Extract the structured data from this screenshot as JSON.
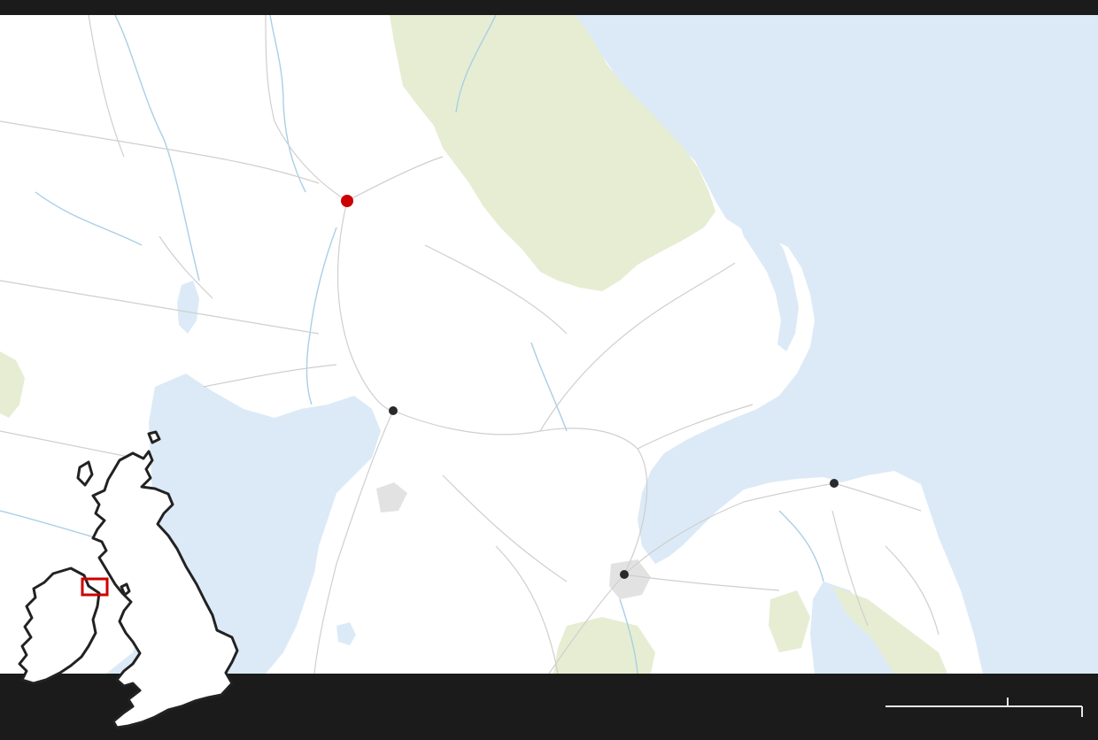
{
  "map": {
    "colors": {
      "land": "#ffffff",
      "water": "#dbeaf6",
      "upland": "#e6edd3",
      "road": "#cfcfcf",
      "river": "#a9cfe6",
      "frame": "#1b1b1b"
    },
    "markers": [
      {
        "id": "primary-location",
        "kind": "primary",
        "color": "#cc0000"
      },
      {
        "id": "town-1",
        "kind": "town",
        "color": "#2a2a2a"
      },
      {
        "id": "town-2",
        "kind": "town",
        "color": "#2a2a2a"
      },
      {
        "id": "town-3",
        "kind": "town",
        "color": "#2a2a2a"
      }
    ]
  },
  "locator": {
    "region": "uk-ireland-outline",
    "highlight_color": "#cc0000",
    "outline_color": "#222222"
  },
  "scale_bar": {
    "color": "#e6e6e6"
  }
}
